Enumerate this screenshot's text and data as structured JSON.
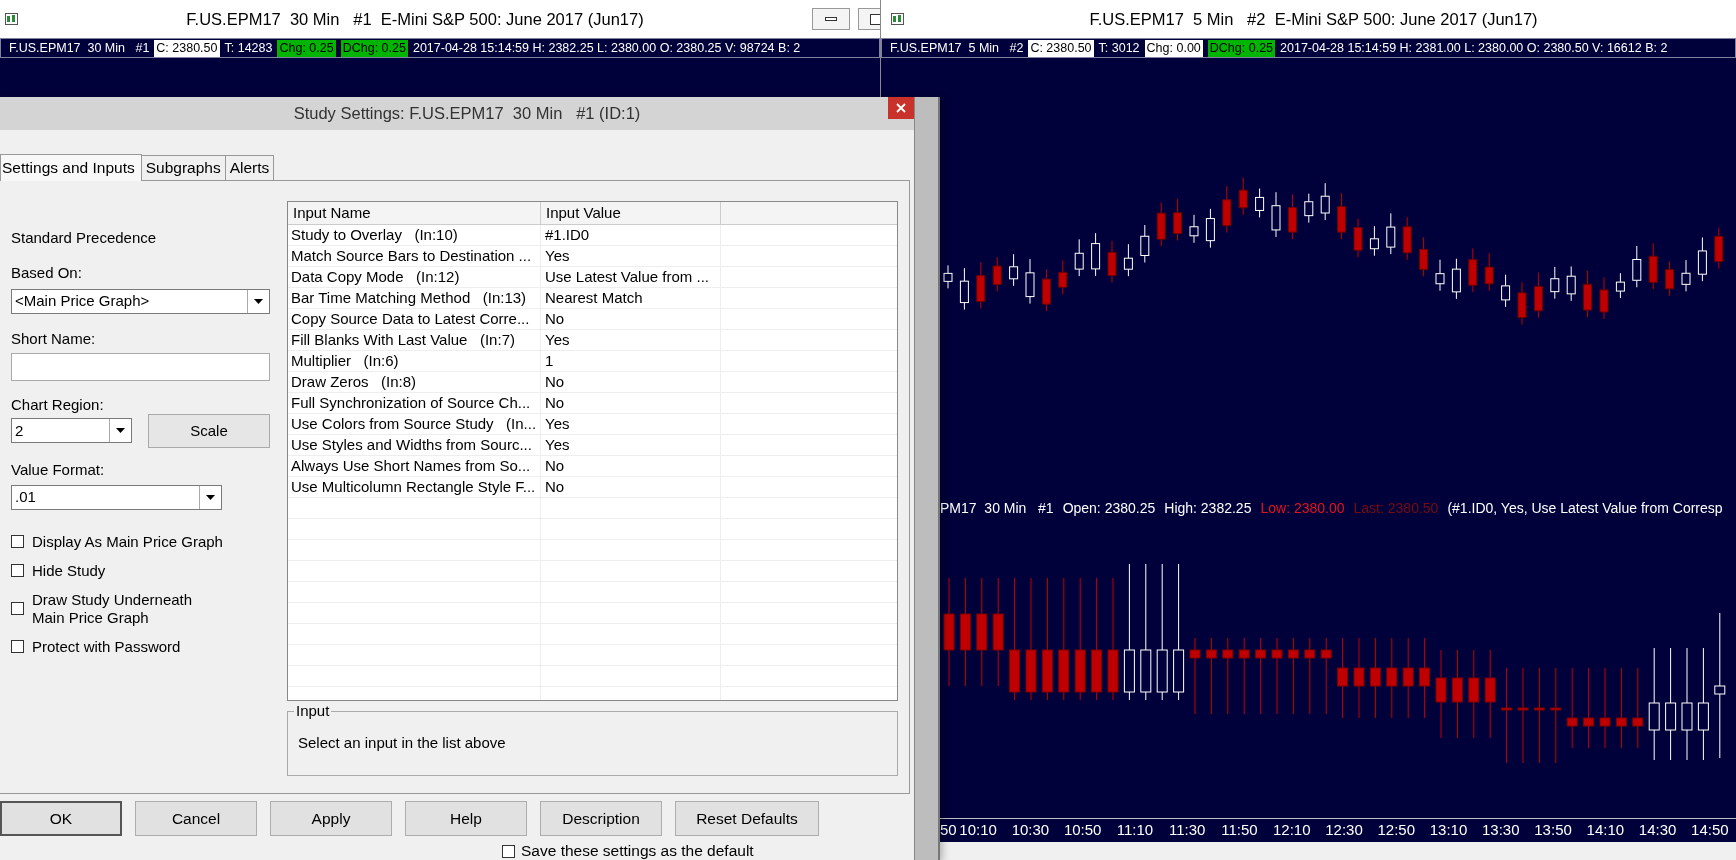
{
  "windows": [
    {
      "title": "F.US.EPM17  30 Min   #1  E-Mini S&P 500: June 2017 (Jun17)",
      "info": [
        {
          "text": "F.US.EPM17  30 Min   #1",
          "kind": "plain"
        },
        {
          "text": "C: 2380.50",
          "kind": "white"
        },
        {
          "text": "T: 14283",
          "kind": "plain"
        },
        {
          "text": "Chg: 0.25",
          "kind": "green"
        },
        {
          "text": "DChg: 0.25",
          "kind": "green"
        },
        {
          "text": "2017-04-28 15:14:59 H: 2382.25 L: 2380.00 O: 2380.25 V: 98724 B: 2",
          "kind": "plain"
        }
      ]
    },
    {
      "title": "F.US.EPM17  5 Min   #2  E-Mini S&P 500: June 2017 (Jun17)",
      "info": [
        {
          "text": "F.US.EPM17  5 Min   #2",
          "kind": "plain"
        },
        {
          "text": "C: 2380.50",
          "kind": "white"
        },
        {
          "text": "T: 3012",
          "kind": "plain"
        },
        {
          "text": "Chg: 0.00",
          "kind": "white"
        },
        {
          "text": "DChg: 0.25",
          "kind": "green"
        },
        {
          "text": "2017-04-28 15:14:59 H: 2381.00 L: 2380.00 O: 2380.50 V: 16612 B: 2",
          "kind": "plain"
        }
      ]
    }
  ],
  "chart": {
    "legend": [
      {
        "text": "PM17  30 Min   #1",
        "color": "#ffffff"
      },
      {
        "text": "Open: 2380.25",
        "color": "#ffffff"
      },
      {
        "text": "High: 2382.25",
        "color": "#ffffff"
      },
      {
        "text": "Low: 2380.00",
        "color": "#e8101c"
      },
      {
        "text": "Last: 2380.50",
        "color": "#7a0a10"
      },
      {
        "text": "(#1.ID0, Yes, Use Latest Value from Corresp",
        "color": "#ffffff"
      }
    ],
    "time_labels": [
      "50",
      "10:10",
      "10:30",
      "10:50",
      "11:10",
      "11:30",
      "11:50",
      "12:10",
      "12:30",
      "12:50",
      "13:10",
      "13:30",
      "13:50",
      "14:10",
      "14:30",
      "14:50"
    ]
  },
  "dialog": {
    "title": "Study Settings: F.US.EPM17  30 Min   #1 (ID:1)",
    "tabs": [
      {
        "label": "Settings and Inputs",
        "selected": true
      },
      {
        "label": "Subgraphs",
        "selected": false
      },
      {
        "label": "Alerts",
        "selected": false
      }
    ],
    "precedence": "Standard Precedence",
    "based_on": {
      "label": "Based On:",
      "value": "<Main Price Graph>"
    },
    "short_name": {
      "label": "Short Name:"
    },
    "chart_region": {
      "label": "Chart Region:",
      "value": "2"
    },
    "scale_button": "Scale",
    "value_format": {
      "label": "Value Format:",
      "value": ".01"
    },
    "checkboxes": [
      {
        "label": "Display As Main Price Graph",
        "checked": false
      },
      {
        "label": "Hide Study",
        "checked": false
      },
      {
        "label": "Draw Study Underneath\nMain Price Graph",
        "checked": false
      },
      {
        "label": "Protect with Password",
        "checked": false
      }
    ],
    "table": {
      "columns": [
        "Input Name",
        "Input Value"
      ],
      "rows": [
        {
          "name": "Study to Overlay   (In:10)",
          "value": "#1.ID0"
        },
        {
          "name": "Match Source Bars to Destination ...",
          "value": "Yes"
        },
        {
          "name": "Data Copy Mode   (In:12)",
          "value": "Use Latest Value from ..."
        },
        {
          "name": "Bar Time Matching Method   (In:13)",
          "value": "Nearest Match"
        },
        {
          "name": "Copy Source Data to Latest Corre...",
          "value": "No"
        },
        {
          "name": "Fill Blanks With Last Value   (In:7)",
          "value": "Yes"
        },
        {
          "name": "Multiplier   (In:6)",
          "value": "1"
        },
        {
          "name": "Draw Zeros   (In:8)",
          "value": "No"
        },
        {
          "name": "Full Synchronization of Source Ch...",
          "value": "No"
        },
        {
          "name": "Use Colors from Source Study   (In...",
          "value": "Yes"
        },
        {
          "name": "Use Styles and Widths from Sourc...",
          "value": "Yes"
        },
        {
          "name": "Always Use Short Names from So...",
          "value": "No"
        },
        {
          "name": "Use Multicolumn Rectangle Style F...",
          "value": "No"
        }
      ]
    },
    "input_group": {
      "title": "Input",
      "text": "Select an input in the list above"
    },
    "buttons": [
      "OK",
      "Cancel",
      "Apply",
      "Help",
      "Description",
      "Reset Defaults"
    ],
    "save_default": {
      "label": "Save these settings as the default",
      "checked": false
    }
  }
}
